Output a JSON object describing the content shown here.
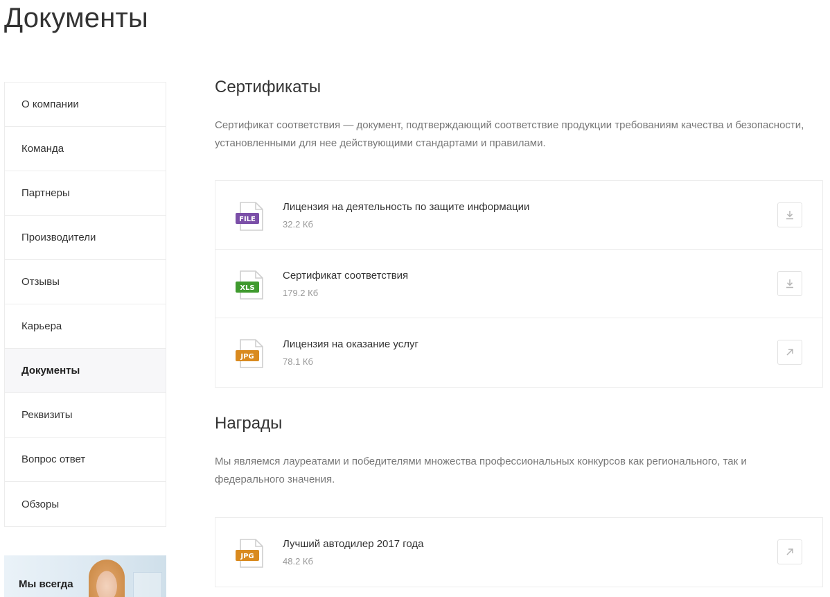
{
  "page": {
    "title": "Документы"
  },
  "sidebar": {
    "items": [
      {
        "label": "О компании",
        "active": false
      },
      {
        "label": "Команда",
        "active": false
      },
      {
        "label": "Партнеры",
        "active": false
      },
      {
        "label": "Производители",
        "active": false
      },
      {
        "label": "Отзывы",
        "active": false
      },
      {
        "label": "Карьера",
        "active": false
      },
      {
        "label": "Документы",
        "active": true
      },
      {
        "label": "Реквизиты",
        "active": false
      },
      {
        "label": "Вопрос ответ",
        "active": false
      },
      {
        "label": "Обзоры",
        "active": false
      }
    ]
  },
  "promo": {
    "text": "Мы всегда"
  },
  "sections": [
    {
      "title": "Сертификаты",
      "description": "Сертификат соответствия — документ, подтверждающий соответствие продукции требованиям качества и безопасности, установленными для нее действующими стандартами и правилами.",
      "docs": [
        {
          "name": "Лицензия на деятельность по защите информации",
          "size": "32.2 Кб",
          "type": "FILE",
          "color": "#7b4fa8",
          "action": "download-icon"
        },
        {
          "name": "Сертификат соответствия",
          "size": "179.2 Кб",
          "type": "XLS",
          "color": "#3f9a2e",
          "action": "download-icon"
        },
        {
          "name": "Лицензия на оказание услуг",
          "size": "78.1 Кб",
          "type": "JPG",
          "color": "#d98a1f",
          "action": "external-link-icon"
        }
      ]
    },
    {
      "title": "Награды",
      "description": "Мы являемся лауреатами и победителями множества профессиональных конкурсов как регионального, так и федерального значения.",
      "docs": [
        {
          "name": "Лучший автодилер 2017 года",
          "size": "48.2 Кб",
          "type": "JPG",
          "color": "#d98a1f",
          "action": "external-link-icon"
        }
      ]
    }
  ]
}
